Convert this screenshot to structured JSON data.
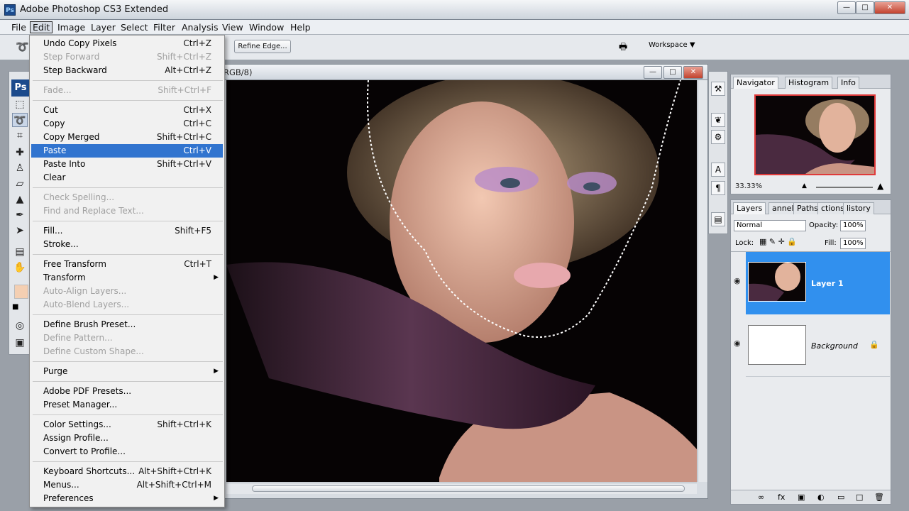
{
  "window": {
    "title": "Adobe Photoshop CS3 Extended",
    "logo": "Ps"
  },
  "menubar": [
    "File",
    "Edit",
    "Image",
    "Layer",
    "Select",
    "Filter",
    "Analysis",
    "View",
    "Window",
    "Help"
  ],
  "options": {
    "refine_edge": "Refine Edge...",
    "workspace": "Workspace ▼"
  },
  "toolbox": {
    "logo": "Ps"
  },
  "document": {
    "title_fragment": "RGB/8)"
  },
  "edit_menu": [
    {
      "label": "Undo Copy Pixels",
      "shortcut": "Ctrl+Z",
      "state": "enabled"
    },
    {
      "label": "Step Forward",
      "shortcut": "Shift+Ctrl+Z",
      "state": "disabled"
    },
    {
      "label": "Step Backward",
      "shortcut": "Alt+Ctrl+Z",
      "state": "enabled"
    },
    {
      "sep": true
    },
    {
      "label": "Fade...",
      "shortcut": "Shift+Ctrl+F",
      "state": "disabled"
    },
    {
      "sep": true
    },
    {
      "label": "Cut",
      "shortcut": "Ctrl+X",
      "state": "enabled"
    },
    {
      "label": "Copy",
      "shortcut": "Ctrl+C",
      "state": "enabled"
    },
    {
      "label": "Copy Merged",
      "shortcut": "Shift+Ctrl+C",
      "state": "enabled"
    },
    {
      "label": "Paste",
      "shortcut": "Ctrl+V",
      "state": "selected"
    },
    {
      "label": "Paste Into",
      "shortcut": "Shift+Ctrl+V",
      "state": "enabled"
    },
    {
      "label": "Clear",
      "shortcut": "",
      "state": "enabled"
    },
    {
      "sep": true
    },
    {
      "label": "Check Spelling...",
      "shortcut": "",
      "state": "disabled"
    },
    {
      "label": "Find and Replace Text...",
      "shortcut": "",
      "state": "disabled"
    },
    {
      "sep": true
    },
    {
      "label": "Fill...",
      "shortcut": "Shift+F5",
      "state": "enabled"
    },
    {
      "label": "Stroke...",
      "shortcut": "",
      "state": "enabled"
    },
    {
      "sep": true
    },
    {
      "label": "Free Transform",
      "shortcut": "Ctrl+T",
      "state": "enabled"
    },
    {
      "label": "Transform",
      "shortcut": "",
      "state": "enabled",
      "submenu": true
    },
    {
      "label": "Auto-Align Layers...",
      "shortcut": "",
      "state": "disabled"
    },
    {
      "label": "Auto-Blend Layers...",
      "shortcut": "",
      "state": "disabled"
    },
    {
      "sep": true
    },
    {
      "label": "Define Brush Preset...",
      "shortcut": "",
      "state": "enabled"
    },
    {
      "label": "Define Pattern...",
      "shortcut": "",
      "state": "disabled"
    },
    {
      "label": "Define Custom Shape...",
      "shortcut": "",
      "state": "disabled"
    },
    {
      "sep": true
    },
    {
      "label": "Purge",
      "shortcut": "",
      "state": "enabled",
      "submenu": true
    },
    {
      "sep": true
    },
    {
      "label": "Adobe PDF Presets...",
      "shortcut": "",
      "state": "enabled"
    },
    {
      "label": "Preset Manager...",
      "shortcut": "",
      "state": "enabled"
    },
    {
      "sep": true
    },
    {
      "label": "Color Settings...",
      "shortcut": "Shift+Ctrl+K",
      "state": "enabled"
    },
    {
      "label": "Assign Profile...",
      "shortcut": "",
      "state": "enabled"
    },
    {
      "label": "Convert to Profile...",
      "shortcut": "",
      "state": "enabled"
    },
    {
      "sep": true
    },
    {
      "label": "Keyboard Shortcuts...",
      "shortcut": "Alt+Shift+Ctrl+K",
      "state": "enabled"
    },
    {
      "label": "Menus...",
      "shortcut": "Alt+Shift+Ctrl+M",
      "state": "enabled"
    },
    {
      "label": "Preferences",
      "shortcut": "",
      "state": "enabled",
      "submenu": true
    }
  ],
  "navigator": {
    "tabs": [
      "Navigator",
      "Histogram",
      "Info"
    ],
    "zoom": "33.33%"
  },
  "layers_panel": {
    "tabs": [
      "Layers",
      "annels",
      "Paths",
      "ctions",
      "listory"
    ],
    "blend_mode": "Normal",
    "opacity_label": "Opacity:",
    "opacity": "100%",
    "lock_label": "Lock:",
    "fill_label": "Fill:",
    "fill": "100%",
    "layers": [
      {
        "name": "Layer 1",
        "selected": true
      },
      {
        "name": "Background",
        "locked": true
      }
    ]
  }
}
